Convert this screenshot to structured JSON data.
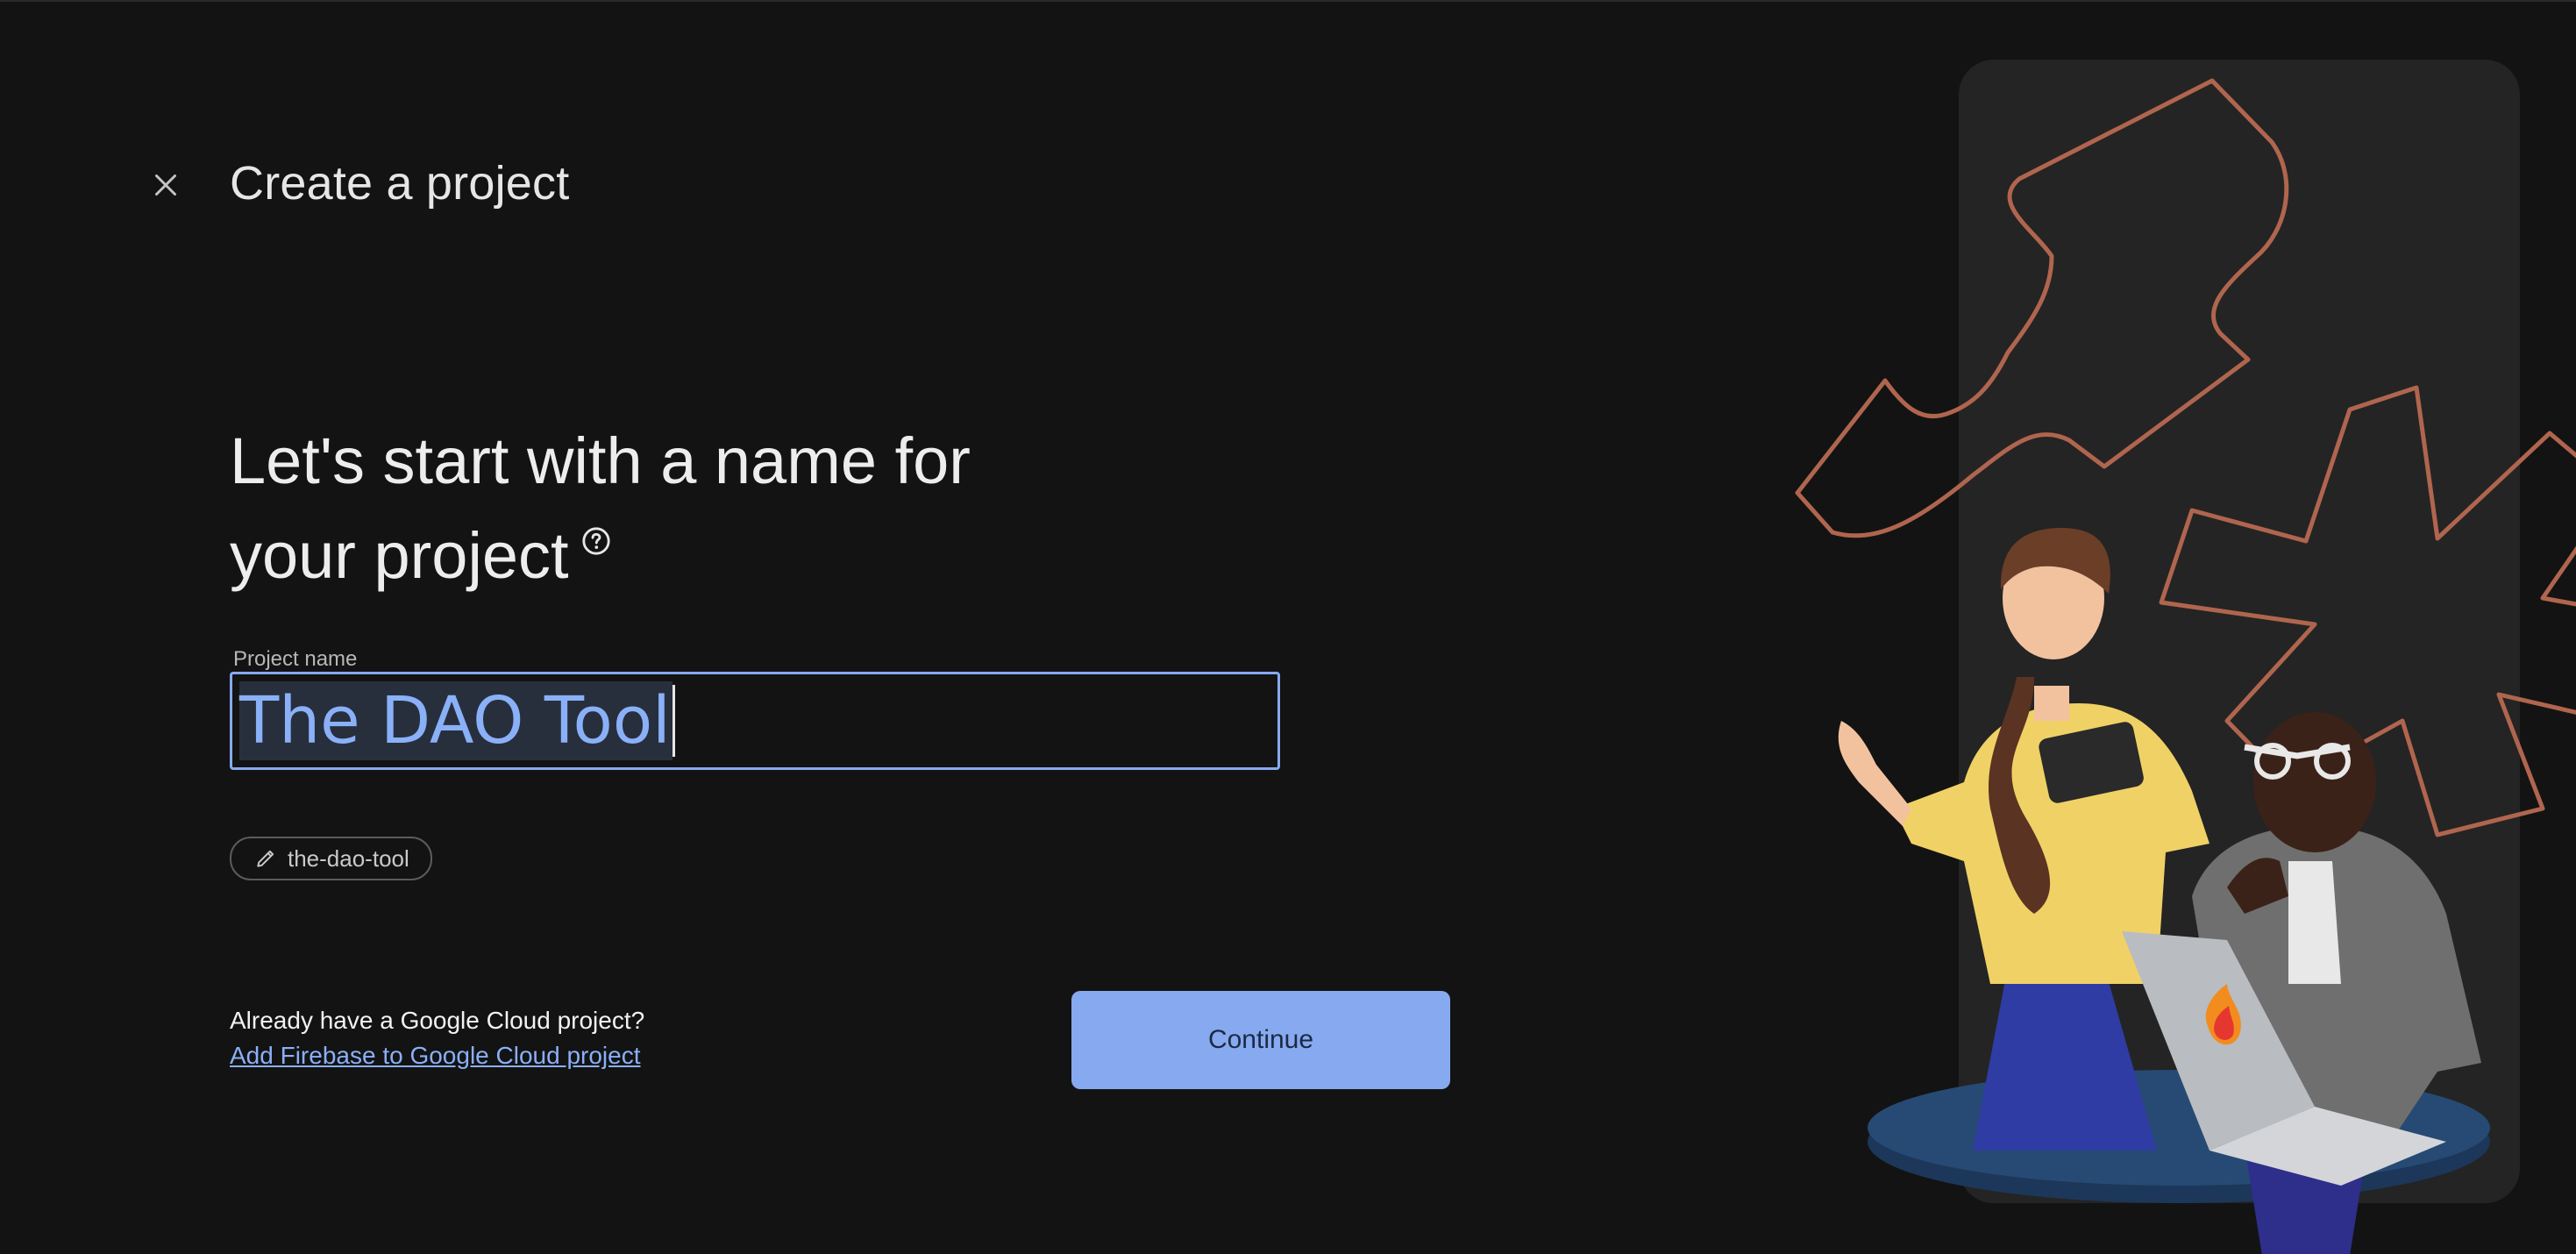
{
  "header": {
    "title": "Create a project",
    "close_icon": "close-icon"
  },
  "main": {
    "heading_line1": "Let's start with a name for",
    "heading_line2": "your project",
    "help_icon": "help-circle-icon",
    "field_label": "Project name",
    "project_name_value": "The DAO Tool",
    "project_id": "the-dao-tool",
    "edit_icon": "pencil-icon"
  },
  "footer": {
    "question": "Already have a Google Cloud project?",
    "link": "Add Firebase to Google Cloud project",
    "continue_label": "Continue"
  },
  "colors": {
    "background": "#131313",
    "accent": "#87a9f0",
    "link": "#8ab0f8",
    "illustration_outline": "#b0654e"
  }
}
